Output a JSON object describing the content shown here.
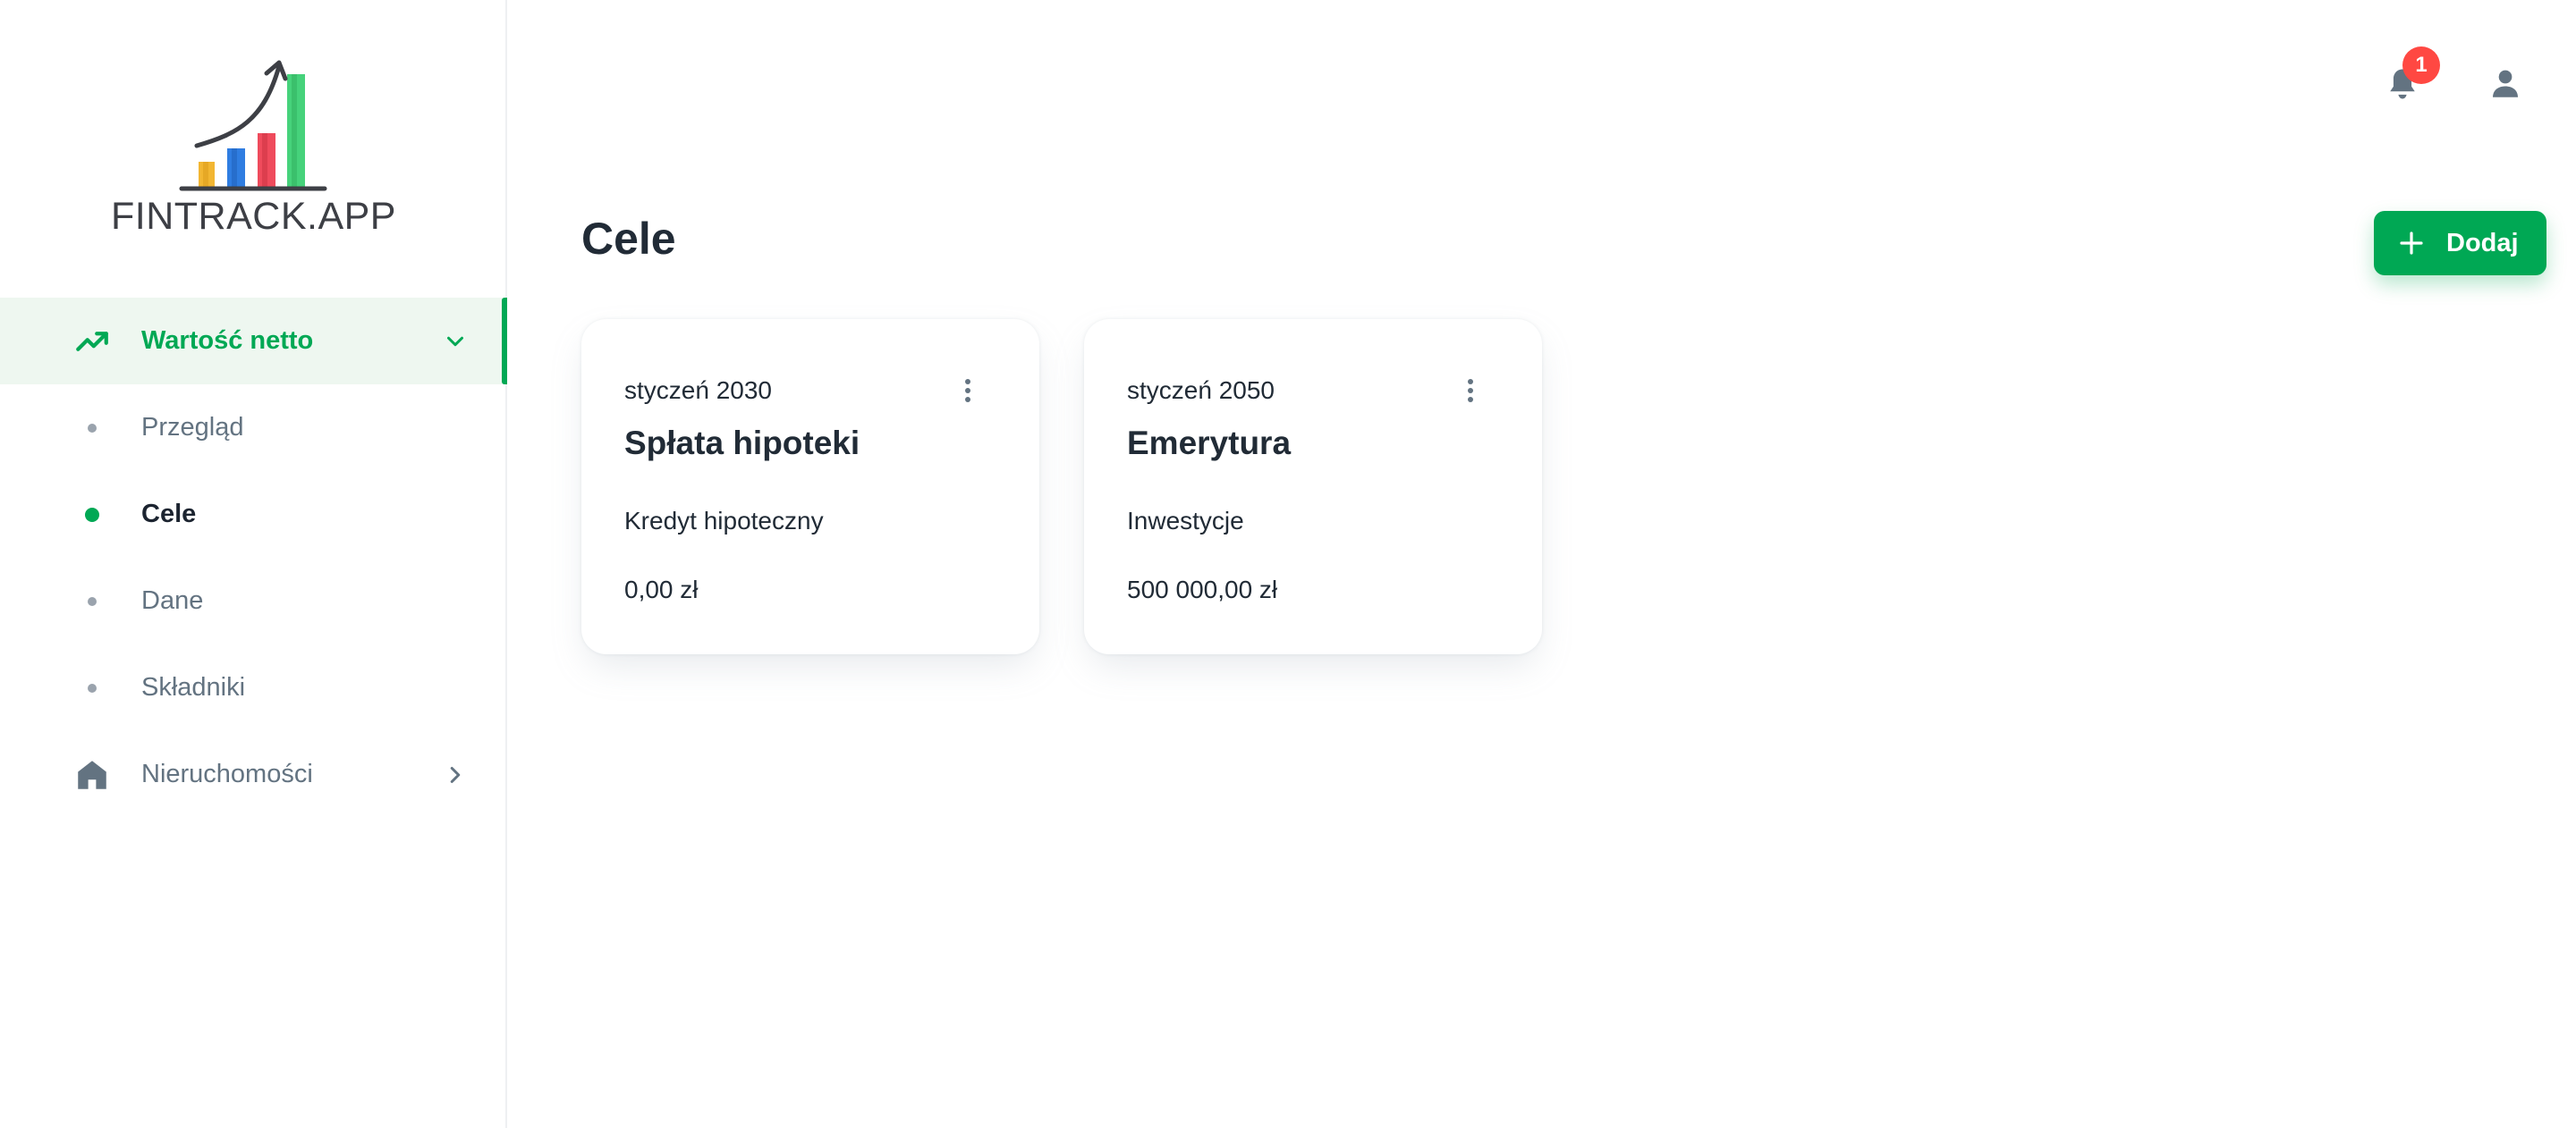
{
  "app": {
    "logo_text": "FINTRACK.APP",
    "accent_color": "#00a854",
    "badge_color": "#ff4842"
  },
  "sidebar": {
    "group_net_worth": {
      "label": "Wartość netto",
      "icon": "trending-up-icon",
      "expanded": true
    },
    "sub_items": [
      {
        "label": "Przegląd",
        "current": false
      },
      {
        "label": "Cele",
        "current": true
      },
      {
        "label": "Dane",
        "current": false
      },
      {
        "label": "Składniki",
        "current": false
      }
    ],
    "group_real_estate": {
      "label": "Nieruchomości",
      "icon": "home-icon",
      "expanded": false
    }
  },
  "header": {
    "notifications_count": "1",
    "bell_icon": "bell-icon",
    "user_icon": "user-icon"
  },
  "main": {
    "title": "Cele",
    "add_button_label": "Dodaj",
    "goals": [
      {
        "date": "styczeń 2030",
        "name": "Spłata hipoteki",
        "category": "Kredyt hipoteczny",
        "amount": "0,00 zł"
      },
      {
        "date": "styczeń 2050",
        "name": "Emerytura",
        "category": "Inwestycje",
        "amount": "500 000,00 zł"
      }
    ]
  }
}
